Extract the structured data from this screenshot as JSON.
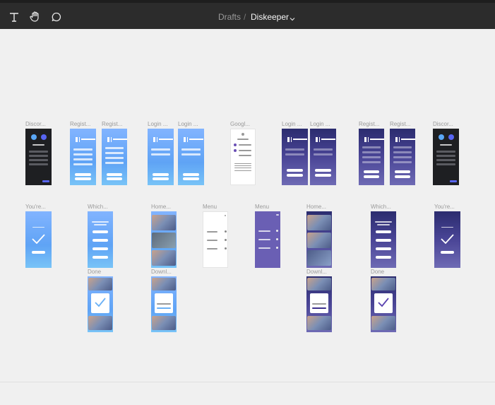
{
  "header": {
    "icons": [
      "text-tool-icon",
      "hand-tool-icon",
      "comment-tool-icon"
    ],
    "breadcrumb_parent": "Drafts",
    "separator": "/",
    "file_name": "Diskeeper",
    "chevron": "⌄"
  },
  "frames": {
    "f1": "Discor...",
    "f2": "Regist...",
    "f3": "Regist...",
    "f4": "Login ...",
    "f5": "Login ...",
    "f6": "Googl...",
    "f7": "Login ...",
    "f8": "Login ...",
    "f9": "Regist...",
    "f10": "Regist...",
    "f11": "Discor...",
    "f12": "You're...",
    "f13": "Which...",
    "f14": "Home...",
    "f15": "Menu",
    "f16": "Menu",
    "f17": "Home...",
    "f18": "Which...",
    "f19": "You're...",
    "f20": "Done",
    "f21": "Downl...",
    "f22": "Downl...",
    "f23": "Done"
  },
  "colors": {
    "toolbar": "#2c2c2c",
    "canvas": "#f0f0f0",
    "blue_gradient": "#6faaf8",
    "purple_gradient": "#4a4596",
    "discord_dark": "#1e1f22"
  }
}
